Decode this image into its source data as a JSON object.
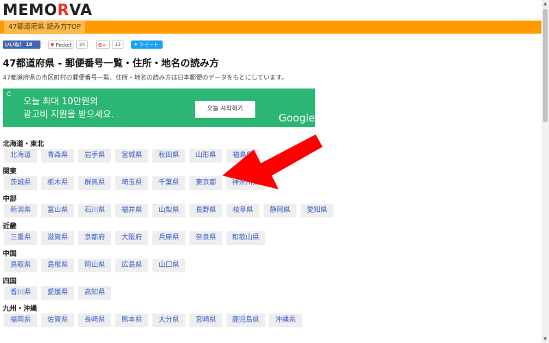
{
  "header": {
    "logo_prefix": "MEMO",
    "logo_accent": "R",
    "logo_suffix": "VA",
    "nav_link": "47都道府県 読み方TOP"
  },
  "social": {
    "facebook": "いいね！ 18",
    "pocket": "Pocket",
    "pocket_count": "34",
    "gplus": "G+",
    "gplus_count": "13",
    "twitter": "ツイート"
  },
  "page": {
    "title": "47都道府県 - 郵便番号一覧・住所・地名の読み方",
    "subtitle": "47都道府県の市区町村の郵便番号一覧、住所・地名の読み方は日本郵便のデータをもとにしています。"
  },
  "ad": {
    "corner": "C",
    "line1": "오늘 최대 10만원의",
    "line2": "광고비 지원을 받으세요.",
    "button": "오늘 시작하기",
    "brand": "Google"
  },
  "regions": [
    {
      "name": "北海道・東北",
      "prefectures": [
        "北海道",
        "青森県",
        "岩手県",
        "宮城県",
        "秋田県",
        "山形県",
        "福島県"
      ]
    },
    {
      "name": "関東",
      "prefectures": [
        "茨城県",
        "栃木県",
        "群馬県",
        "埼玉県",
        "千葉県",
        "東京都",
        "神奈川県"
      ]
    },
    {
      "name": "中部",
      "prefectures": [
        "新潟県",
        "富山県",
        "石川県",
        "福井県",
        "山梨県",
        "長野県",
        "岐阜県",
        "静岡県",
        "愛知県"
      ]
    },
    {
      "name": "近畿",
      "prefectures": [
        "三重県",
        "滋賀県",
        "京都府",
        "大阪府",
        "兵庫県",
        "奈良県",
        "和歌山県"
      ]
    },
    {
      "name": "中国",
      "prefectures": [
        "鳥取県",
        "島根県",
        "岡山県",
        "広島県",
        "山口県"
      ]
    },
    {
      "name": "四国",
      "prefectures": [
        "香川県",
        "愛媛県",
        "高知県"
      ]
    },
    {
      "name": "九州・沖縄",
      "prefectures": [
        "福岡県",
        "佐賀県",
        "長崎県",
        "熊本県",
        "大分県",
        "宮崎県",
        "鹿児島県",
        "沖縄県"
      ]
    }
  ],
  "colors": {
    "nav_bar": "#ff9900",
    "logo_accent": "#e8332a",
    "ad_background": "#2bb673",
    "link": "#3a5fcd",
    "arrow": "#ff0000"
  }
}
